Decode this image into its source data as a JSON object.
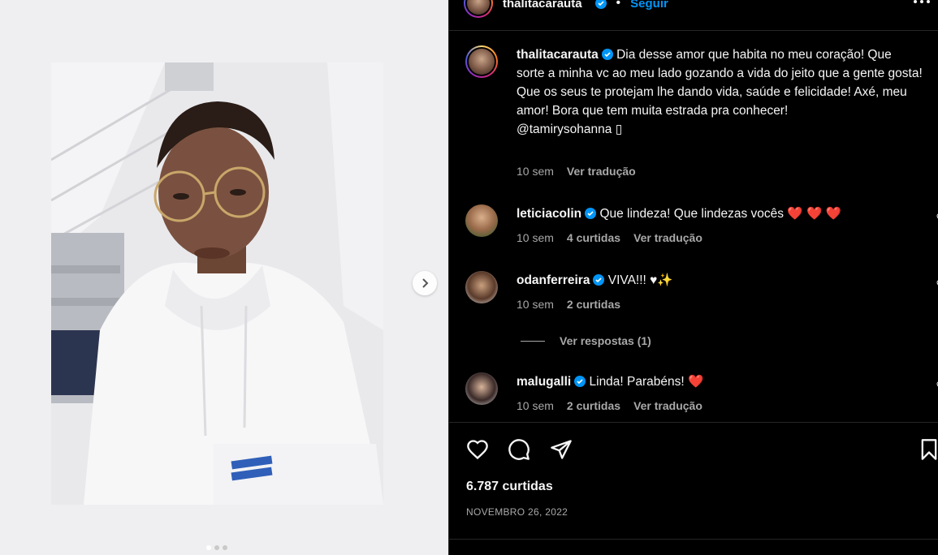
{
  "post": {
    "username": "thalitacarauta",
    "follow_label": "Seguir",
    "caption_line": "Dia desse amor que habita no meu coração! Que sorte a minha vc ao meu lado gozando a vida do jeito que a gente gosta! Que os seus te protejam lhe dando vida, saúde e felicidade! Axé, meu amor! Bora que tem muita estrada pra conhecer!",
    "caption_mention": "@tamirysohanna ▯",
    "caption_time": "10 sem",
    "caption_translate": "Ver tradução",
    "likes": "6.787 curtidas",
    "date": "NOVEMBRO 26, 2022"
  },
  "comments": [
    {
      "username": "leticiacolin",
      "text": "Que lindeza! Que lindezas vocês",
      "emoji": "❤️ ❤️ ❤️",
      "time": "10 sem",
      "likes": "4 curtidas",
      "translate": "Ver tradução"
    },
    {
      "username": "odanferreira",
      "text": "VIVA!!!",
      "emoji": "♥✨",
      "time": "10 sem",
      "likes": "2 curtidas",
      "translate": ""
    },
    {
      "username": "malugalli",
      "text": "Linda! Parabéns!",
      "emoji": "❤️",
      "time": "10 sem",
      "likes": "2 curtidas",
      "translate": "Ver tradução"
    }
  ],
  "replies_label": "Ver respostas (1)",
  "icons": [
    "verified-icon",
    "more-icon",
    "chevron-right-icon",
    "heart-icon",
    "comment-icon",
    "share-icon",
    "bookmark-icon"
  ],
  "carousel": {
    "count": 3,
    "active": 0
  },
  "colors": {
    "link_blue": "#0095f6",
    "muted": "#a8a8a8",
    "like_red": "#ff2d3a"
  }
}
